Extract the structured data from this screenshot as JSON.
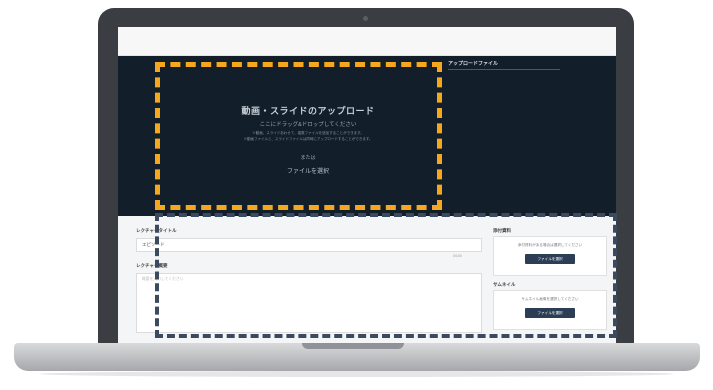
{
  "upload_area": {
    "title": "動画・スライドのアップロード",
    "subtitle": "ここにドラッグ&ドロップしてください",
    "hint_lines": [
      "※動画、スライドあわせて、複数ファイルを追加することができます。",
      "※動画ファイルと、スライドファイルは同時にアップロードすることができます。"
    ],
    "or_label": "または",
    "select_label": "ファイルを選択"
  },
  "uploaded_files": {
    "label": "アップロードファイル"
  },
  "form": {
    "title_label": "レクチャータイトル",
    "title_value": "エピソード",
    "char_count": "0/100",
    "desc_label": "レクチャー概要",
    "desc_placeholder": "概要を入力してください"
  },
  "sidebar": {
    "attachment": {
      "label": "添付資料",
      "hint": "添付資料がある場合は選択してください",
      "button": "ファイルを選択"
    },
    "thumbnail": {
      "label": "サムネイル",
      "hint": "サムネイル画像を選択してください",
      "button": "ファイルを選択"
    }
  },
  "colors": {
    "dark_panel": "#131e2b",
    "orange_highlight": "#f5a71d",
    "slate_highlight": "#3b4a5f",
    "button": "#2c3e55"
  }
}
